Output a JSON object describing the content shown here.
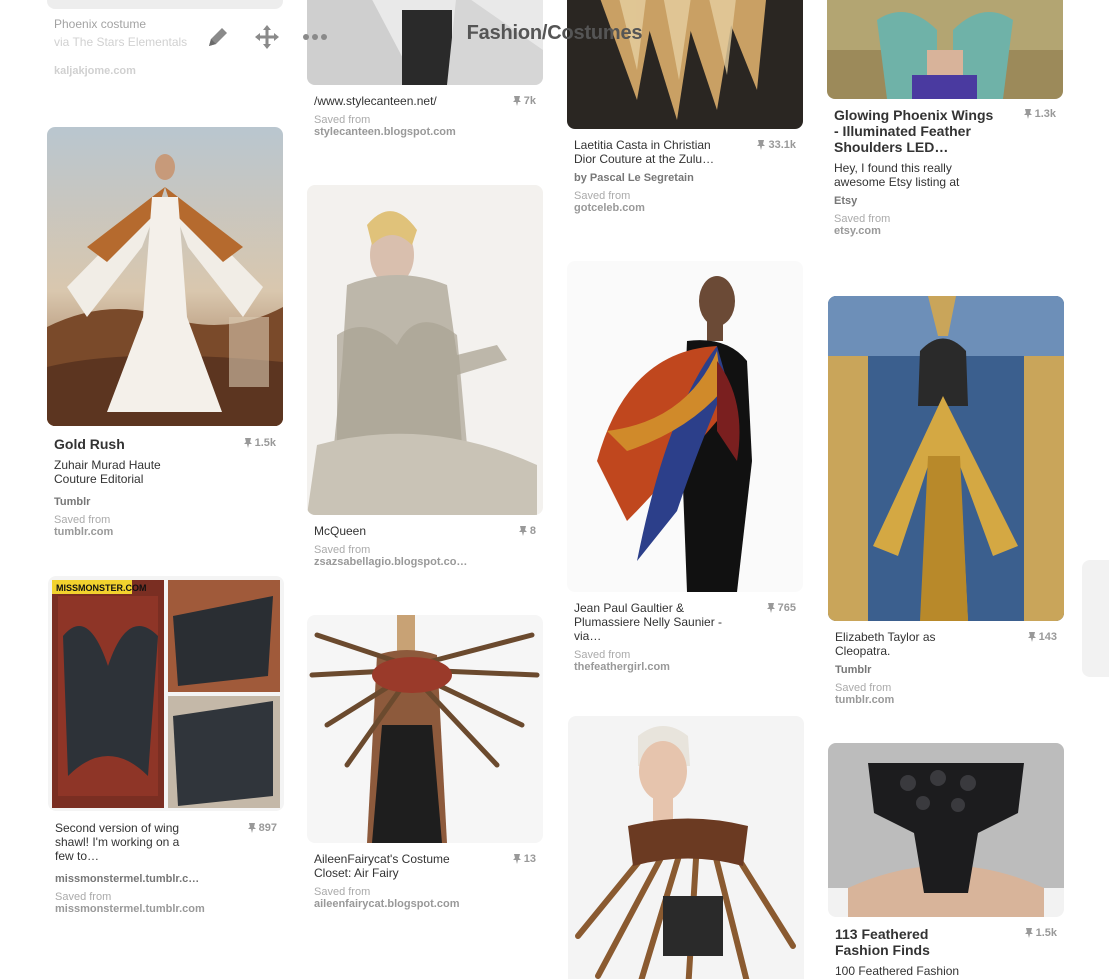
{
  "header": {
    "title": "Fashion/Costumes",
    "icons": [
      "edit-icon",
      "move-icon",
      "more-icon"
    ]
  },
  "pins": [
    {
      "id": "p0",
      "title": "Phoenix costume",
      "desc": "via The Stars Elementals",
      "src": "kaljakjome.com"
    },
    {
      "id": "p1",
      "title": "Gold Rush",
      "desc": "Zuhair Murad Haute Couture Editorial",
      "by": "Tumblr",
      "saved": "Saved from",
      "src": "tumblr.com",
      "count": "1.5k",
      "image": "Woman in white gown with golden feather wings in desert, magazine page 'Flight of Fancy'"
    },
    {
      "id": "p2",
      "title": "Second version of wing shawl! I'm working on a few to…",
      "by": "missmonstermel.tumblr.c…",
      "saved": "Saved from",
      "src": "missmonstermel.tumblr.com",
      "count": "897",
      "image": "Collage of dark leather feather wing shawl on patterned rug",
      "badge": "MISSMONSTER.COM"
    },
    {
      "id": "p3",
      "title": "/www.stylecanteen.net/",
      "saved": "Saved from",
      "src": "stylecanteen.blogspot.com",
      "count": "7k"
    },
    {
      "id": "p4",
      "title": "McQueen",
      "saved": "Saved from",
      "src": "zsazsabellagio.blogspot.co…",
      "count": "8",
      "image": "Model in grey feather gown by McQueen"
    },
    {
      "id": "p5",
      "title": "AileenFairycat's Costume Closet: Air Fairy",
      "saved": "Saved from",
      "src": "aileenfairycat.blogspot.com",
      "count": "13",
      "image": "Pheasant feather shoulder wings on mannequin"
    },
    {
      "id": "p6",
      "title": "Laetitia Casta in Christian Dior Couture at the Zulu…",
      "by": "by Pascal Le Segretain",
      "saved": "Saved from",
      "src": "gotceleb.com",
      "count": "33.1k"
    },
    {
      "id": "p7",
      "title": "Jean Paul Gaultier & Plumassiere Nelly Saunier - via…",
      "saved": "Saved from",
      "src": "thefeathergirl.com",
      "count": "765",
      "image": "Model with colorful feather shoulder piece"
    },
    {
      "id": "p8",
      "image": "Blonde woman wearing pheasant feather wing shawl"
    },
    {
      "id": "p9",
      "title": "Glowing Phoenix Wings - Illuminated Feather Shoulders LED…",
      "desc": "Hey, I found this really awesome Etsy listing at",
      "by": "Etsy",
      "saved": "Saved from",
      "src": "etsy.com",
      "count": "1.3k"
    },
    {
      "id": "p10",
      "title": "Elizabeth Taylor as Cleopatra.",
      "by": "Tumblr",
      "saved": "Saved from",
      "src": "tumblr.com",
      "count": "143",
      "image": "Elizabeth Taylor as Cleopatra in golden wing gown"
    },
    {
      "id": "p11",
      "title": "113 Feathered Fashion Finds",
      "desc": "100 Feathered Fashion",
      "count": "1.5k",
      "image": "Back view of black feather collar"
    }
  ],
  "colors": {
    "title": "#555555",
    "count": "#999999",
    "source": "#999999"
  }
}
